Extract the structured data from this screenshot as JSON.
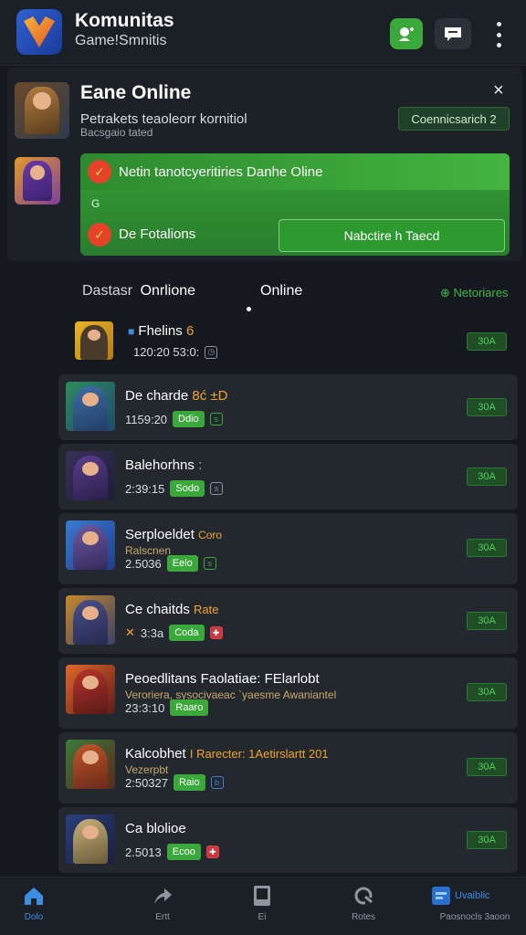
{
  "header": {
    "title": "Komunitas",
    "subtitle": "Game!Smnitis"
  },
  "panel": {
    "title": "Eane Online",
    "close": "×",
    "desc_line1": "Petrakets teaoleorr kornitiol",
    "desc_line2": "Bacsgaio tated",
    "community_button": "Coennicsarich 2",
    "banner": {
      "line1": "Netin tanotcyeritiries Danhe Oline",
      "mid": "G",
      "line2": "De Fotalions",
      "button": "Nabctire h Taecd"
    }
  },
  "tabs": {
    "tab1": "Dastasr",
    "tab1_strong": "Onrlione",
    "tab2": "Online",
    "network": "⊕ Netoriares"
  },
  "members": [
    {
      "name": "Fhelins",
      "accent": "6",
      "sub": "",
      "meta": "120:20 53:0:",
      "badge": "",
      "icon": "clock",
      "status": "30A"
    },
    {
      "name": "De charde",
      "accent": "8ć ±D",
      "sub": "",
      "meta": "1159:20",
      "badge": "Ddio",
      "icon": "s",
      "status": "30A"
    },
    {
      "name": "Balehorhns",
      "accent": ":",
      "sub": "",
      "meta": "2:39:15",
      "badge": "Sodo",
      "icon": "s",
      "status": "30A"
    },
    {
      "name": "Serploeldet",
      "accent": "Coro",
      "sub": "Ralscnen",
      "meta": "2.5036",
      "badge": "Eelo",
      "icon": "s",
      "status": "30A"
    },
    {
      "name": "Ce chaitds",
      "accent": "Rate",
      "sub": "",
      "meta": "3:3a",
      "badge": "Coda",
      "icon": "x",
      "status": "30A"
    },
    {
      "name": "Peoedlitans",
      "accent": "Faolatiae: FElarlobt",
      "sub": "Veroriera, sysocivaeac `yaesme Awaniantel",
      "meta": "23:3:10",
      "badge": "Raaro",
      "icon": "",
      "status": "30A"
    },
    {
      "name": "Kalcobhet",
      "accent": "I Rarecter: 1Aetirslartt 201",
      "sub": "Vezerpbt",
      "meta": "2:50327",
      "badge": "Raio",
      "icon": "b",
      "status": "30A"
    },
    {
      "name": "Ca blolioe",
      "accent": "",
      "sub": "",
      "meta": "2.5013",
      "badge": "Ecoo",
      "icon": "x",
      "status": "30A"
    }
  ],
  "bottom_nav": [
    {
      "label": "Dolo",
      "icon": "home-icon"
    },
    {
      "label": "Ertt",
      "icon": "share-icon"
    },
    {
      "label": "Ei",
      "icon": "tablet-icon"
    },
    {
      "label": "Rotes",
      "icon": "refresh-icon"
    },
    {
      "label": "Paosnocls 3aoon",
      "icon": "app-icon",
      "extra": "Uvaiblic"
    }
  ],
  "colors": {
    "accent_green": "#3aa83a",
    "background": "#15191f",
    "active_nav": "#3b8ee0"
  }
}
